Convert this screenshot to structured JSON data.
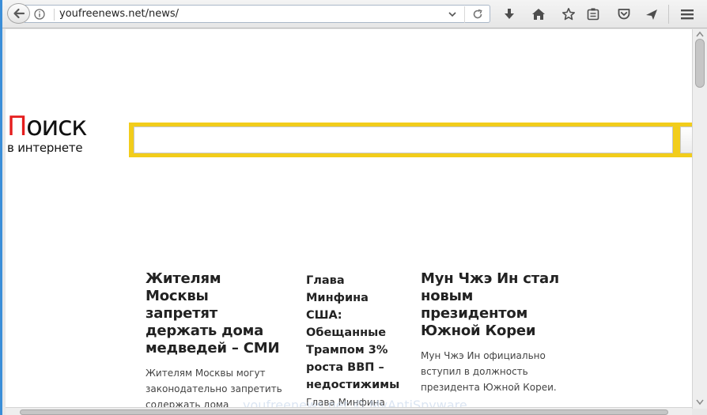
{
  "browser": {
    "url": "youfreenews.net/news/"
  },
  "page": {
    "logo": {
      "first_letter": "П",
      "rest": "оиск",
      "subtitle": "в интернете"
    },
    "search": {
      "placeholder": ""
    },
    "news": [
      {
        "title": "Жителям Москвы запретят держать дома медведей – СМИ",
        "text": "Жителям Москвы могут законодательно запретить содержать дома медведей."
      },
      {
        "title": "Глава Минфина США: Обещанные Трампом 3% роста ВВП – недостижимы",
        "text": "Глава Минфина"
      },
      {
        "title": "Мун Чжэ Ин стал новым президентом Южной Кореи",
        "text": "Мун Чжэ Ин официально вступил в должность президента Южной Кореи."
      }
    ],
    "watermark": "youfreenews.net © MyAntiSpyware"
  },
  "colors": {
    "accent_left_border": "#3b8ed8",
    "logo_red": "#e51d1d",
    "search_frame": "#f2cd1b"
  },
  "icons": [
    "back-arrow-icon",
    "info-icon",
    "dropdown-arrow-icon",
    "reload-icon",
    "download-icon",
    "home-icon",
    "bookmark-star-icon",
    "reading-list-icon",
    "pocket-icon",
    "send-tab-icon",
    "hamburger-menu-icon"
  ]
}
